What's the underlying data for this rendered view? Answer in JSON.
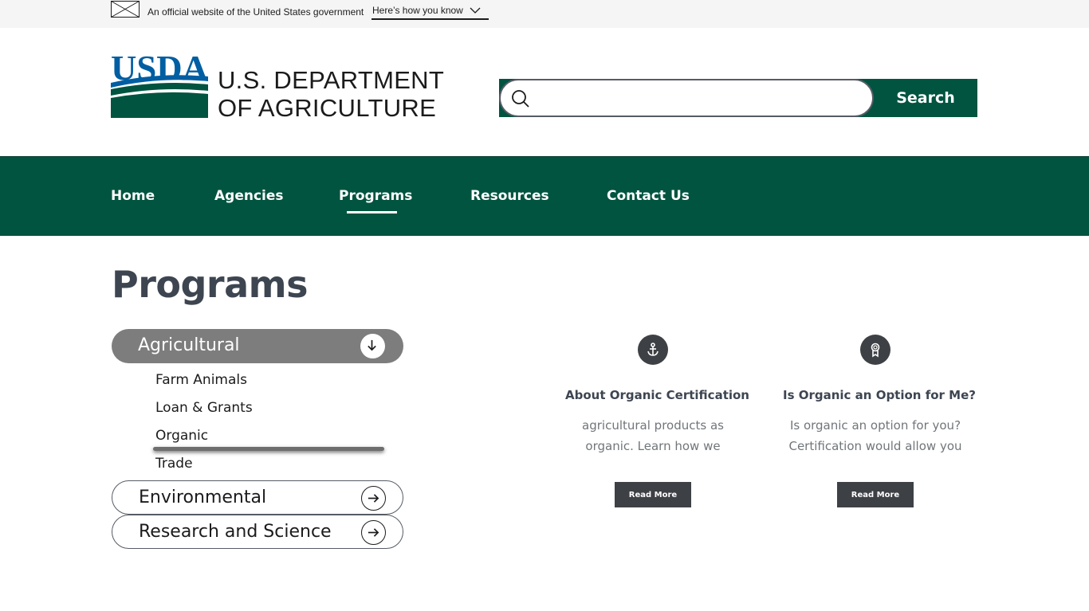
{
  "gov_banner": {
    "text": "An official website of the United States government",
    "link_label": "Here’s how you know"
  },
  "header": {
    "logo_text": "USDA",
    "dept_line1": "U.S. DEPARTMENT",
    "dept_line2": "OF AGRICULTURE",
    "search": {
      "placeholder": "",
      "value": "",
      "button_label": "Search"
    }
  },
  "nav": {
    "items": [
      {
        "label": "Home"
      },
      {
        "label": "Agencies"
      },
      {
        "label": "Programs",
        "active": true
      },
      {
        "label": "Resources"
      },
      {
        "label": "Contact Us"
      }
    ]
  },
  "main": {
    "title": "Programs",
    "accordion": [
      {
        "label": "Agricultural",
        "expanded": true,
        "icon": "arrow-down-icon",
        "items": [
          {
            "label": "Farm Animals"
          },
          {
            "label": "Loan & Grants"
          },
          {
            "label": "Organic",
            "selected": true
          },
          {
            "label": "Trade"
          }
        ]
      },
      {
        "label": "Environmental",
        "expanded": false,
        "icon": "arrow-right-icon"
      },
      {
        "label": "Research and Science",
        "expanded": false,
        "icon": "arrow-right-icon"
      }
    ],
    "cards": [
      {
        "icon": "anchor-icon",
        "title": "About Organic Certification",
        "text_line1": "agricultural products as",
        "text_line2": "organic. Learn how we",
        "button_label": "Read More"
      },
      {
        "icon": "award-icon",
        "title": "Is Organic an Option for Me?",
        "text_line1": "Is organic an option for you?",
        "text_line2": "Certification would allow you",
        "button_label": "Read More"
      }
    ]
  },
  "colors": {
    "brand_green": "#005440",
    "usda_blue": "#005ea2",
    "accordion_active": "#7d7d7d",
    "dark_button": "#3d4044"
  }
}
